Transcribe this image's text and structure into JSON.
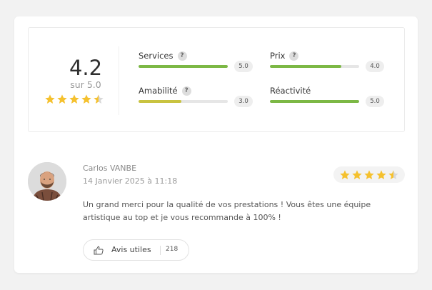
{
  "summary": {
    "score": "4.2",
    "score_sub": "sur 5.0",
    "rating": 4.5,
    "criteria": [
      {
        "label": "Services",
        "value": "5.0",
        "fraction": 1.0,
        "color": "#7cb845",
        "help": true
      },
      {
        "label": "Prix",
        "value": "4.0",
        "fraction": 0.8,
        "color": "#7cb845",
        "help": true
      },
      {
        "label": "Amabilité",
        "value": "3.0",
        "fraction": 0.48,
        "color": "#c9c340",
        "help": true
      },
      {
        "label": "Réactivité",
        "value": "5.0",
        "fraction": 1.0,
        "color": "#7cb845",
        "help": false
      }
    ],
    "help_glyph": "?"
  },
  "review": {
    "author": "Carlos VANBE",
    "date": "14 Janvier 2025 à 11:18",
    "rating": 4.5,
    "text": "Un grand merci pour la qualité de vos prestations ! Vous êtes une équipe artistique au top et je vous recommande à 100% !",
    "helpful_label": "Avis utiles",
    "helpful_count": "218"
  },
  "colors": {
    "star": "#f5c12e",
    "star_empty": "#d8d8d8"
  }
}
